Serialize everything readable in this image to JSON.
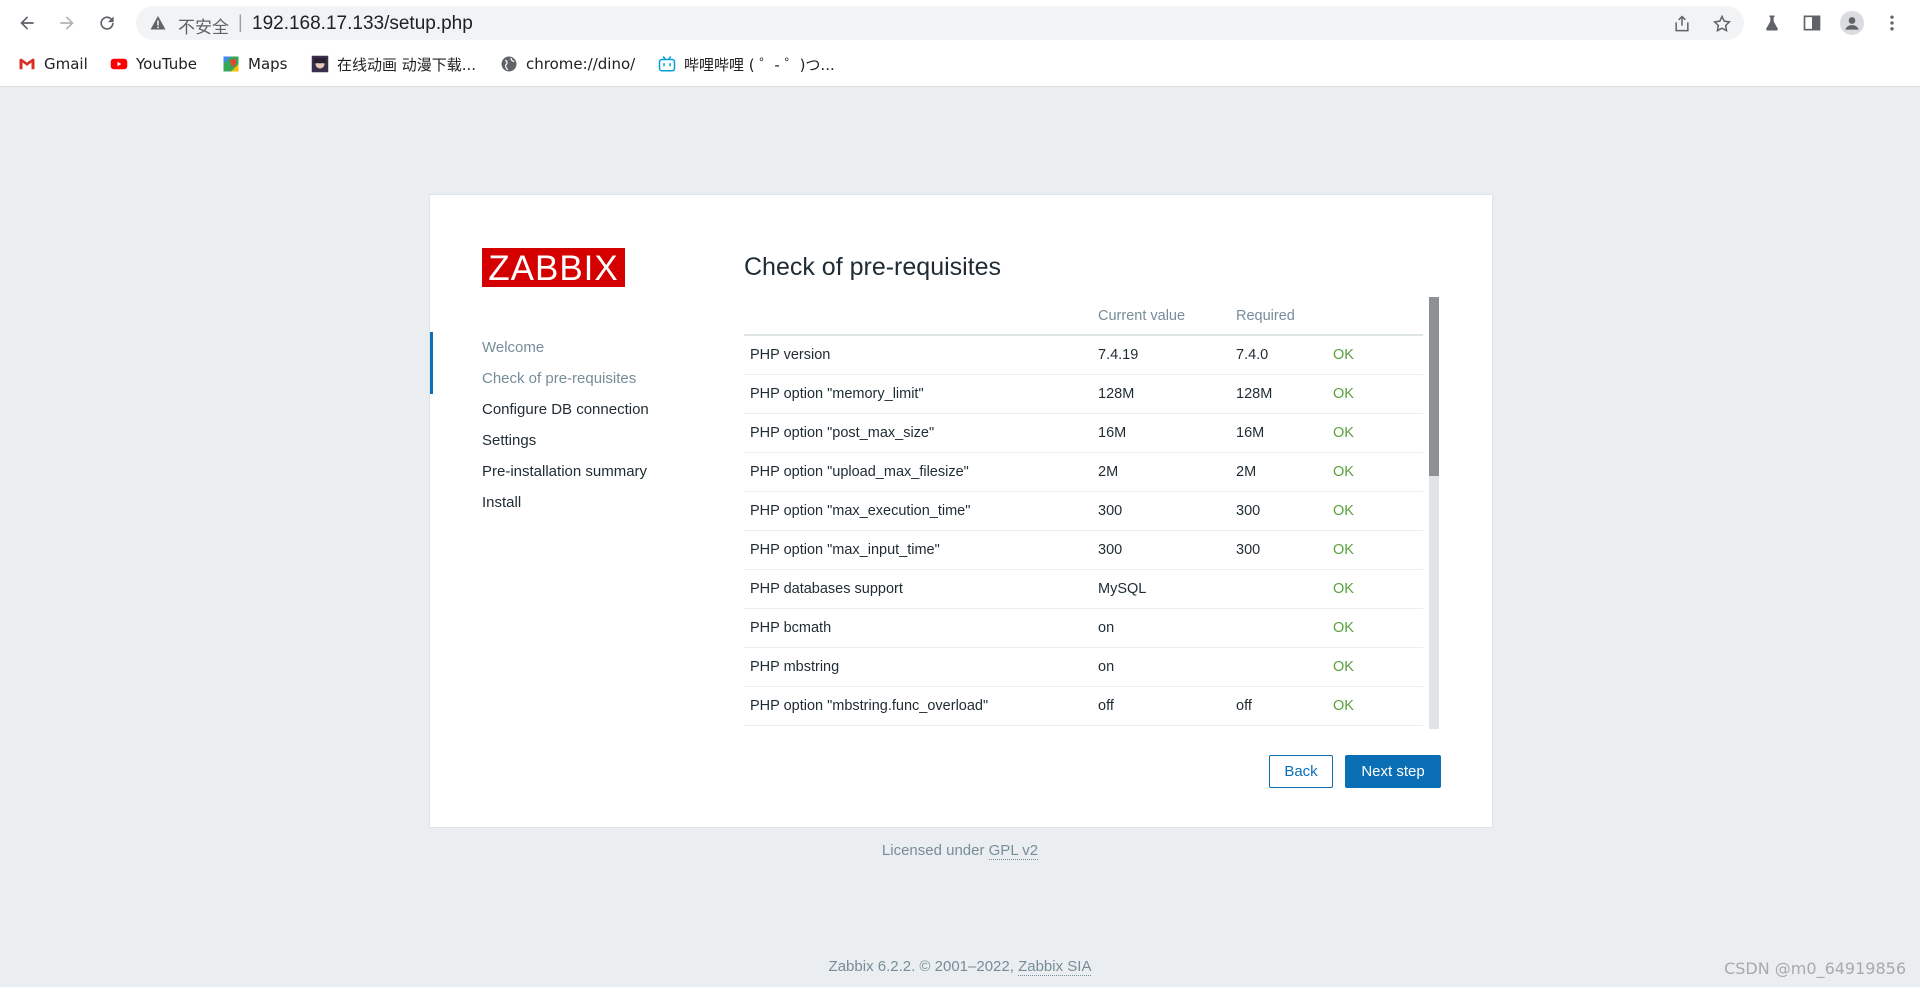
{
  "browser": {
    "security_label": "不安全",
    "url": "192.168.17.133/setup.php",
    "bookmarks": [
      {
        "label": "Gmail",
        "icon": "gmail-icon"
      },
      {
        "label": "YouTube",
        "icon": "youtube-icon"
      },
      {
        "label": "Maps",
        "icon": "maps-icon"
      },
      {
        "label": "在线动画 动漫下载...",
        "icon": "anime-avatar-icon"
      },
      {
        "label": "chrome://dino/",
        "icon": "globe-icon"
      },
      {
        "label": "哔哩哔哩 ( ゜- ゜)つ...",
        "icon": "bilibili-icon"
      }
    ]
  },
  "setup": {
    "logo_text": "ZABBIX",
    "steps": [
      "Welcome",
      "Check of pre-requisites",
      "Configure DB connection",
      "Settings",
      "Pre-installation summary",
      "Install"
    ],
    "active_step": "Check of pre-requisites",
    "title": "Check of pre-requisites",
    "columns": [
      "",
      "Current value",
      "Required",
      ""
    ],
    "rows": [
      {
        "name": "PHP version",
        "current": "7.4.19",
        "required": "7.4.0",
        "status": "OK"
      },
      {
        "name": "PHP option \"memory_limit\"",
        "current": "128M",
        "required": "128M",
        "status": "OK"
      },
      {
        "name": "PHP option \"post_max_size\"",
        "current": "16M",
        "required": "16M",
        "status": "OK"
      },
      {
        "name": "PHP option \"upload_max_filesize\"",
        "current": "2M",
        "required": "2M",
        "status": "OK"
      },
      {
        "name": "PHP option \"max_execution_time\"",
        "current": "300",
        "required": "300",
        "status": "OK"
      },
      {
        "name": "PHP option \"max_input_time\"",
        "current": "300",
        "required": "300",
        "status": "OK"
      },
      {
        "name": "PHP databases support",
        "current": "MySQL",
        "required": "",
        "status": "OK"
      },
      {
        "name": "PHP bcmath",
        "current": "on",
        "required": "",
        "status": "OK"
      },
      {
        "name": "PHP mbstring",
        "current": "on",
        "required": "",
        "status": "OK"
      },
      {
        "name": "PHP option \"mbstring.func_overload\"",
        "current": "off",
        "required": "off",
        "status": "OK"
      }
    ],
    "back_label": "Back",
    "next_label": "Next step"
  },
  "license": {
    "prefix": "Licensed under ",
    "link": "GPL v2"
  },
  "footer": {
    "prefix": "Zabbix 6.2.2. © 2001–2022, ",
    "link": "Zabbix SIA"
  },
  "watermark": "CSDN @m0_64919856",
  "colors": {
    "brand_red": "#d40000",
    "accent_blue": "#0a6fb5",
    "ok_green": "#59a13d"
  }
}
